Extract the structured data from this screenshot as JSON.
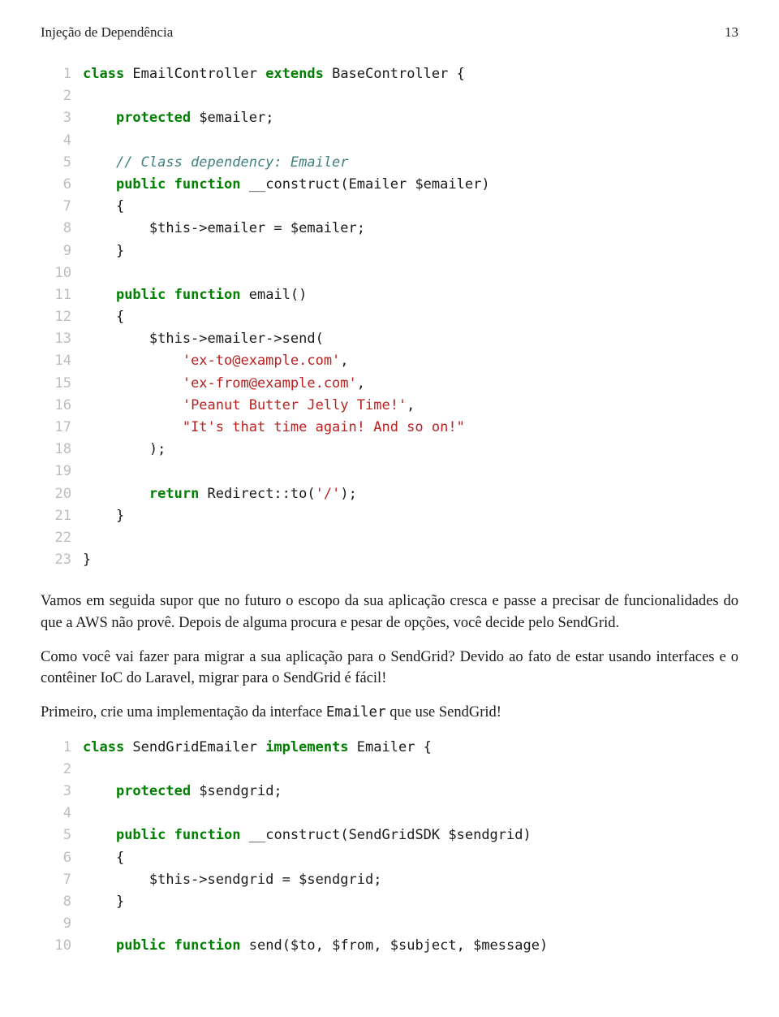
{
  "header": {
    "title": "Injeção de Dependência",
    "page_number": "13"
  },
  "code1": {
    "lines": [
      {
        "n": "1",
        "tokens": [
          {
            "t": "",
            "c": "plain"
          },
          {
            "t": "class",
            "c": "kw"
          },
          {
            "t": " EmailController ",
            "c": "plain"
          },
          {
            "t": "extends",
            "c": "kw"
          },
          {
            "t": " BaseController {",
            "c": "plain"
          }
        ]
      },
      {
        "n": "2",
        "tokens": [
          {
            "t": "",
            "c": "plain"
          }
        ]
      },
      {
        "n": "3",
        "tokens": [
          {
            "t": "    ",
            "c": "plain"
          },
          {
            "t": "protected",
            "c": "kw"
          },
          {
            "t": " $emailer;",
            "c": "plain"
          }
        ]
      },
      {
        "n": "4",
        "tokens": [
          {
            "t": "",
            "c": "plain"
          }
        ]
      },
      {
        "n": "5",
        "tokens": [
          {
            "t": "    ",
            "c": "plain"
          },
          {
            "t": "// Class dependency: Emailer",
            "c": "cmt"
          }
        ]
      },
      {
        "n": "6",
        "tokens": [
          {
            "t": "    ",
            "c": "plain"
          },
          {
            "t": "public",
            "c": "kw"
          },
          {
            "t": " ",
            "c": "plain"
          },
          {
            "t": "function",
            "c": "kw"
          },
          {
            "t": " __construct(Emailer $emailer)",
            "c": "plain"
          }
        ]
      },
      {
        "n": "7",
        "tokens": [
          {
            "t": "    {",
            "c": "plain"
          }
        ]
      },
      {
        "n": "8",
        "tokens": [
          {
            "t": "        $this->emailer = $emailer;",
            "c": "plain"
          }
        ]
      },
      {
        "n": "9",
        "tokens": [
          {
            "t": "    }",
            "c": "plain"
          }
        ]
      },
      {
        "n": "10",
        "tokens": [
          {
            "t": "",
            "c": "plain"
          }
        ]
      },
      {
        "n": "11",
        "tokens": [
          {
            "t": "    ",
            "c": "plain"
          },
          {
            "t": "public",
            "c": "kw"
          },
          {
            "t": " ",
            "c": "plain"
          },
          {
            "t": "function",
            "c": "kw"
          },
          {
            "t": " email()",
            "c": "plain"
          }
        ]
      },
      {
        "n": "12",
        "tokens": [
          {
            "t": "    {",
            "c": "plain"
          }
        ]
      },
      {
        "n": "13",
        "tokens": [
          {
            "t": "        $this->emailer->send(",
            "c": "plain"
          }
        ]
      },
      {
        "n": "14",
        "tokens": [
          {
            "t": "            ",
            "c": "plain"
          },
          {
            "t": "'ex-to@example.com'",
            "c": "str"
          },
          {
            "t": ",",
            "c": "plain"
          }
        ]
      },
      {
        "n": "15",
        "tokens": [
          {
            "t": "            ",
            "c": "plain"
          },
          {
            "t": "'ex-from@example.com'",
            "c": "str"
          },
          {
            "t": ",",
            "c": "plain"
          }
        ]
      },
      {
        "n": "16",
        "tokens": [
          {
            "t": "            ",
            "c": "plain"
          },
          {
            "t": "'Peanut Butter Jelly Time!'",
            "c": "str"
          },
          {
            "t": ",",
            "c": "plain"
          }
        ]
      },
      {
        "n": "17",
        "tokens": [
          {
            "t": "            ",
            "c": "plain"
          },
          {
            "t": "\"It's that time again! And so on!\"",
            "c": "str"
          }
        ]
      },
      {
        "n": "18",
        "tokens": [
          {
            "t": "        );",
            "c": "plain"
          }
        ]
      },
      {
        "n": "19",
        "tokens": [
          {
            "t": "",
            "c": "plain"
          }
        ]
      },
      {
        "n": "20",
        "tokens": [
          {
            "t": "        ",
            "c": "plain"
          },
          {
            "t": "return",
            "c": "kw"
          },
          {
            "t": " Redirect::to(",
            "c": "plain"
          },
          {
            "t": "'/'",
            "c": "str"
          },
          {
            "t": ");",
            "c": "plain"
          }
        ]
      },
      {
        "n": "21",
        "tokens": [
          {
            "t": "    }",
            "c": "plain"
          }
        ]
      },
      {
        "n": "22",
        "tokens": [
          {
            "t": "",
            "c": "plain"
          }
        ]
      },
      {
        "n": "23",
        "tokens": [
          {
            "t": "}",
            "c": "plain"
          }
        ]
      }
    ]
  },
  "paragraphs": {
    "p1": "Vamos em seguida supor que no futuro o escopo da sua aplicação cresca e passe a precisar de funcionalidades do que a AWS não provê. Depois de alguma procura e pesar de opções, você decide pelo SendGrid.",
    "p2": "Como você vai fazer para migrar a sua aplicação para o SendGrid? Devido ao fato de estar usando interfaces e o contêiner IoC do Laravel, migrar para o SendGrid é fácil!",
    "p3_pre": "Primeiro, crie uma implementação da interface ",
    "p3_code": "Emailer",
    "p3_post": " que use SendGrid!"
  },
  "code2": {
    "lines": [
      {
        "n": "1",
        "tokens": [
          {
            "t": "",
            "c": "plain"
          },
          {
            "t": "class",
            "c": "kw"
          },
          {
            "t": " SendGridEmailer ",
            "c": "plain"
          },
          {
            "t": "implements",
            "c": "kw"
          },
          {
            "t": " Emailer {",
            "c": "plain"
          }
        ]
      },
      {
        "n": "2",
        "tokens": [
          {
            "t": "",
            "c": "plain"
          }
        ]
      },
      {
        "n": "3",
        "tokens": [
          {
            "t": "    ",
            "c": "plain"
          },
          {
            "t": "protected",
            "c": "kw"
          },
          {
            "t": " $sendgrid;",
            "c": "plain"
          }
        ]
      },
      {
        "n": "4",
        "tokens": [
          {
            "t": "",
            "c": "plain"
          }
        ]
      },
      {
        "n": "5",
        "tokens": [
          {
            "t": "    ",
            "c": "plain"
          },
          {
            "t": "public",
            "c": "kw"
          },
          {
            "t": " ",
            "c": "plain"
          },
          {
            "t": "function",
            "c": "kw"
          },
          {
            "t": " __construct(SendGridSDK $sendgrid)",
            "c": "plain"
          }
        ]
      },
      {
        "n": "6",
        "tokens": [
          {
            "t": "    {",
            "c": "plain"
          }
        ]
      },
      {
        "n": "7",
        "tokens": [
          {
            "t": "        $this->sendgrid = $sendgrid;",
            "c": "plain"
          }
        ]
      },
      {
        "n": "8",
        "tokens": [
          {
            "t": "    }",
            "c": "plain"
          }
        ]
      },
      {
        "n": "9",
        "tokens": [
          {
            "t": "",
            "c": "plain"
          }
        ]
      },
      {
        "n": "10",
        "tokens": [
          {
            "t": "    ",
            "c": "plain"
          },
          {
            "t": "public",
            "c": "kw"
          },
          {
            "t": " ",
            "c": "plain"
          },
          {
            "t": "function",
            "c": "kw"
          },
          {
            "t": " send($to, $from, $subject, $message)",
            "c": "plain"
          }
        ]
      }
    ]
  }
}
